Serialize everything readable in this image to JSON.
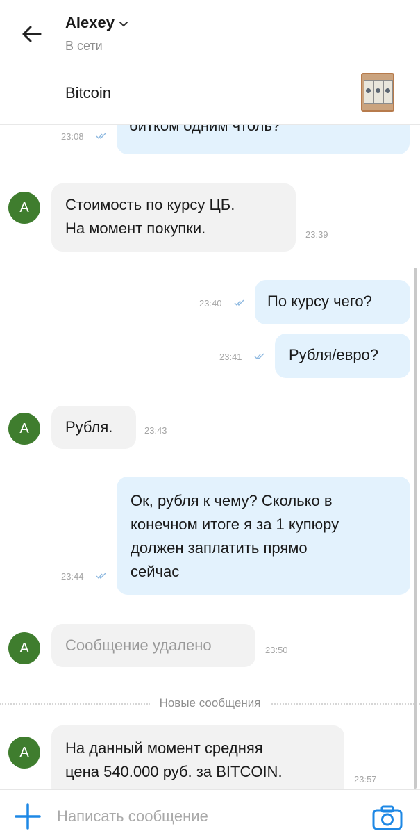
{
  "header": {
    "name": "Alexey",
    "status": "В сети"
  },
  "product": {
    "title": "Bitcoin"
  },
  "messages": [
    {
      "dir": "out",
      "text": "битком одним чтоль?",
      "time": "23:08"
    },
    {
      "dir": "in",
      "avatar": "A",
      "text": "Стоимость по курсу ЦБ.\nНа момент покупки.",
      "time": "23:39"
    },
    {
      "dir": "out",
      "text": "По курсу чего?",
      "time": "23:40"
    },
    {
      "dir": "out",
      "text": "Рубля/евро?",
      "time": "23:41"
    },
    {
      "dir": "in",
      "avatar": "A",
      "text": "Рубля.",
      "time": "23:43"
    },
    {
      "dir": "out",
      "text": "Ок, рубля к чему? Сколько в\nконечном итоге я за 1 купюру\nдолжен заплатить прямо\nсейчас",
      "time": "23:44"
    },
    {
      "dir": "in",
      "avatar": "A",
      "text": "Сообщение удалено",
      "time": "23:50",
      "deleted": true
    },
    {
      "dir": "in",
      "avatar": "A",
      "text": "На данный момент средняя\nцена 540.000 руб. за BITCOIN.",
      "time": "23:57"
    }
  ],
  "divider": {
    "label": "Новые сообщения"
  },
  "composer": {
    "placeholder": "Написать сообщение"
  },
  "colors": {
    "outgoing_bubble": "#e3f2fd",
    "incoming_bubble": "#f2f2f2",
    "avatar": "#3f7d2e",
    "accent": "#1e88e5"
  },
  "icons": [
    "back-arrow-icon",
    "chevron-down-icon",
    "double-check-icon",
    "plus-icon",
    "camera-icon"
  ]
}
